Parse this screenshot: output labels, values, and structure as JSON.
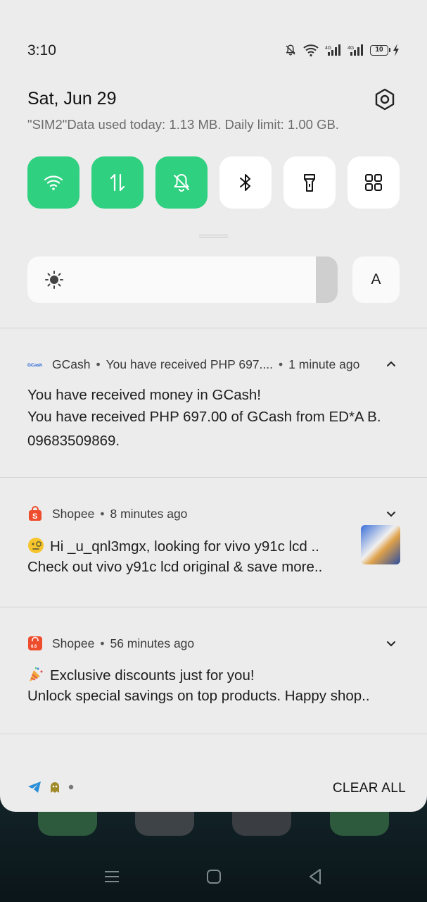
{
  "status_bar": {
    "time": "3:10",
    "battery_level": "10",
    "icons": [
      "mute-icon",
      "wifi-icon",
      "signal-icon",
      "signal-icon",
      "battery-icon",
      "charging-icon"
    ]
  },
  "header": {
    "date": "Sat, Jun 29",
    "data_usage": "\"SIM2\"Data used today: 1.13 MB. Daily limit: 1.00 GB."
  },
  "quick_tiles": [
    {
      "icon": "wifi-icon",
      "active": true
    },
    {
      "icon": "mobile-data-icon",
      "active": true
    },
    {
      "icon": "mute-icon",
      "active": true
    },
    {
      "icon": "bluetooth-icon",
      "active": false
    },
    {
      "icon": "flashlight-icon",
      "active": false
    },
    {
      "icon": "apps-grid-icon",
      "active": false
    }
  ],
  "brightness": {
    "level": 0.93,
    "auto_label": "A"
  },
  "notifications": [
    {
      "app": "GCash",
      "summary": "You have received PHP 697....",
      "time": "1 minute ago",
      "title": "You have received money in GCash!",
      "lines": [
        "You have received PHP 697.00 of GCash from ED*A B.",
        "09683509869."
      ],
      "expanded": true
    },
    {
      "app": "Shopee",
      "time": "8 minutes ago",
      "title": "Hi _u_qnl3mgx, looking for vivo y91c lcd ..",
      "lines": [
        "Check out vivo y91c lcd original & save more.."
      ],
      "has_thumbnail": true
    },
    {
      "app": "Shopee",
      "time": "56 minutes ago",
      "title": "Exclusive discounts just for you!",
      "lines": [
        "Unlock special savings on top products. Happy shop.."
      ]
    }
  ],
  "footer": {
    "clear_all": "CLEAR ALL"
  },
  "colors": {
    "accent": "#2fd07f",
    "panel": "#ececec",
    "shopee": "#ee4d2d",
    "gcash": "#1a5fd6"
  }
}
